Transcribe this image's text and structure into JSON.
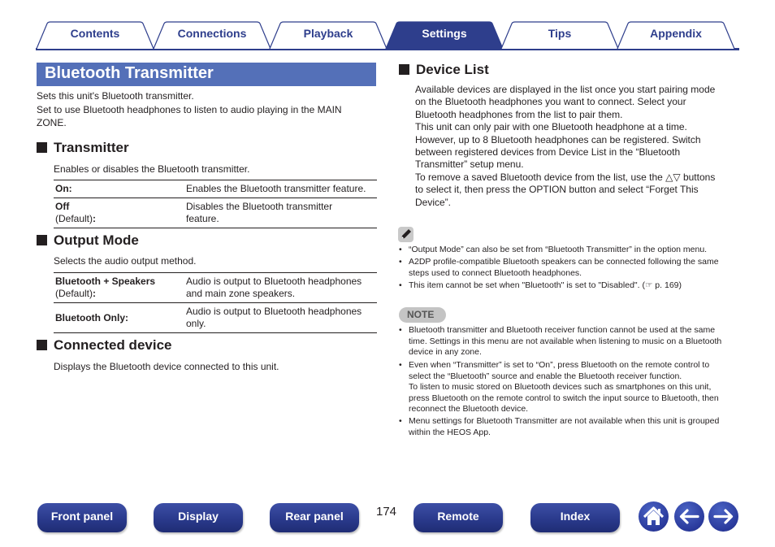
{
  "tabs": [
    {
      "label": "Contents",
      "active": false
    },
    {
      "label": "Connections",
      "active": false
    },
    {
      "label": "Playback",
      "active": false
    },
    {
      "label": "Settings",
      "active": true
    },
    {
      "label": "Tips",
      "active": false
    },
    {
      "label": "Appendix",
      "active": false
    }
  ],
  "colors": {
    "brand": "#2e3e8c",
    "title_bar": "#5470b8"
  },
  "page": {
    "title": "Bluetooth Transmitter",
    "intro": [
      "Sets this unit's Bluetooth transmitter.",
      "Set to use Bluetooth headphones to listen to audio playing in the MAIN",
      "ZONE."
    ],
    "transmitter": {
      "heading": "Transmitter",
      "desc": "Enables or disables the Bluetooth transmitter.",
      "rows": [
        {
          "key": "On:",
          "key_sub": "",
          "value": [
            "Enables the Bluetooth transmitter feature."
          ]
        },
        {
          "key": "Off",
          "key_sub": "(Default)",
          "key_colon": ":",
          "value": [
            "Disables the Bluetooth transmitter",
            "feature."
          ]
        }
      ]
    },
    "output_mode": {
      "heading": "Output Mode",
      "desc": "Selects the audio output method.",
      "rows": [
        {
          "key": "Bluetooth + Speakers",
          "key_sub": "(Default)",
          "key_colon": ":",
          "value": [
            "Audio is output to Bluetooth headphones",
            "and main zone speakers."
          ]
        },
        {
          "key": "Bluetooth Only:",
          "key_sub": "",
          "value": [
            "Audio is output to Bluetooth headphones",
            "only."
          ]
        }
      ]
    },
    "connected_device": {
      "heading": "Connected device",
      "desc": "Displays the Bluetooth device connected to this unit."
    },
    "device_list": {
      "heading": "Device List",
      "lines": [
        "Available devices are displayed in the list once you start pairing mode",
        "on the Bluetooth headphones you want to connect. Select your",
        "Bluetooth headphones from the list to pair them.",
        "This unit can only pair with one Bluetooth headphone at a time.",
        "However, up to 8 Bluetooth headphones can be registered. Switch",
        "between registered devices from Device List in the “Bluetooth",
        "Transmitter” setup menu.",
        "To remove a saved Bluetooth device from the list, use the △▽ buttons",
        "to select it, then press the OPTION button and select “Forget This",
        "Device”."
      ]
    },
    "tips": {
      "icon": "pencil-icon",
      "items": [
        [
          "“Output Mode” can also be set from “Bluetooth Transmitter” in the option menu."
        ],
        [
          "A2DP profile-compatible Bluetooth speakers can be connected following the same",
          "steps used to connect Bluetooth headphones."
        ],
        [
          "This item cannot be set when \"Bluetooth\" is set to \"Disabled\".  (☞ p. 169)"
        ]
      ]
    },
    "note": {
      "label": "NOTE",
      "items": [
        [
          "Bluetooth transmitter and Bluetooth receiver function cannot be used at the same",
          "time. Settings in this menu are not available when listening to music on a Bluetooth",
          "device in any zone."
        ],
        [
          "Even when “Transmitter” is set to “On”, press Bluetooth on the remote control to",
          "select the “Bluetooth” source and enable the Bluetooth receiver function.",
          "To listen to music stored on Bluetooth devices such as smartphones on this unit,",
          "press Bluetooth on the remote control to switch the input source to Bluetooth, then",
          "reconnect the Bluetooth device."
        ],
        [
          "Menu settings for Bluetooth Transmitter are not available when this unit is grouped",
          "within the HEOS App."
        ]
      ]
    }
  },
  "footer": {
    "buttons": [
      "Front panel",
      "Display",
      "Rear panel",
      "Remote",
      "Index"
    ],
    "page_number": "174",
    "icons": [
      "home-icon",
      "back-arrow-icon",
      "forward-arrow-icon"
    ]
  }
}
